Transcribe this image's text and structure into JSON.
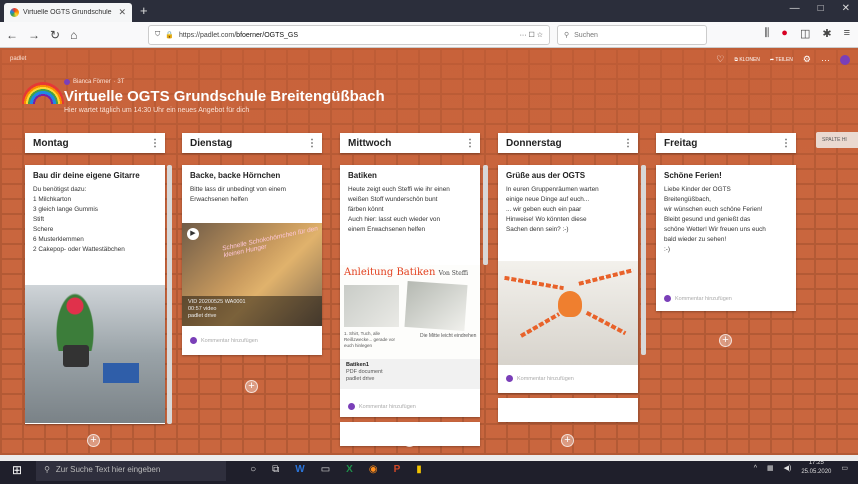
{
  "browser": {
    "tab_title": "Virtuelle OGTS Grundschule Br",
    "tab_close": "✕",
    "new_tab": "+",
    "window_controls": [
      "—",
      "□",
      "✕"
    ],
    "url_prefix": "https://padlet.com/",
    "url_path": "bfoerner/OGTS_GS",
    "url_actions": "··· ☐ ☆",
    "search_placeholder": "Suchen",
    "nav_icons": [
      "back-icon",
      "forward-icon",
      "reload-icon",
      "home-icon"
    ],
    "right_icons": [
      "library-icon",
      "pocket-icon",
      "sidebar-icon",
      "extensions-icon",
      "menu-icon"
    ]
  },
  "padlet": {
    "brand": "padlet",
    "actions": {
      "clone": "KLONEN",
      "share": "TEILEN"
    },
    "author": "Bianca Förner",
    "author_time": "· 3T",
    "title": "Virtuelle OGTS Grundschule Breitengüßbach",
    "subtitle": "Hier wartet täglich um 14:30 Uhr ein neues Angebot für dich",
    "add_column": "SPALTE HI",
    "comment_placeholder": "Kommentar hinzufügen",
    "plus": "+"
  },
  "columns": [
    {
      "title": "Montag",
      "card_title": "Bau dir deine eigene Gitarre",
      "lines": [
        "Du benötigst dazu:",
        "1 Milchkarton",
        "3 gleich lange Gummis",
        "Stift",
        "Schere",
        "6 Musterklemmen",
        "2 Cakepop- oder Wattestäbchen"
      ]
    },
    {
      "title": "Dienstag",
      "card_title": "Backe, backe Hörnchen",
      "lines": [
        "Bitte lass dir unbedingt von einem",
        "Erwachsenen helfen"
      ],
      "video_name": "VID 20200525 WA0001",
      "video_meta": "00:57 video",
      "video_source": "padlet drive",
      "overlay_text": "Schnelle Schokohörnchen für den kleinen Hunger"
    },
    {
      "title": "Mittwoch",
      "card_title": "Batiken",
      "lines": [
        "Heute zeigt euch Steffi wie ihr einen",
        "weißen Stoff wunderschön bunt",
        "färben könnt",
        "Auch hier: lasst euch wieder von",
        "einem Erwachsenen helfen"
      ],
      "doc_heading": "Anleitung Batiken",
      "doc_heading_by": "Von Steffi",
      "doc_note_1": "1. Shirt, Tuch, alle Reißzwecke... gerade vor euch hinlegen",
      "doc_note_2": "Die Mitte leicht eindrehen",
      "file_name": "Batiken1",
      "file_type": "PDF document",
      "file_source": "padlet drive"
    },
    {
      "title": "Donnerstag",
      "card_title": "Grüße aus der OGTS",
      "lines": [
        "In euren Gruppenräumen warten",
        "einige neue Dinge auf euch...",
        "... wir geben euch ein paar",
        "Hinweise! Wo könnten diese",
        "Sachen denn sein? :-)"
      ]
    },
    {
      "title": "Freitag",
      "card_title": "Schöne Ferien!",
      "lines": [
        "Liebe Kinder der OGTS",
        "Breitengüßbach,",
        "wir wünschen euch schöne Ferien!",
        "Bleibt gesund und genießt das",
        "schöne Wetter! Wir freuen uns euch",
        "bald wieder zu sehen!",
        ":-)"
      ]
    }
  ],
  "taskbar": {
    "search_placeholder": "Zur Suche Text hier eingeben",
    "time": "17:25",
    "date": "25.05.2020"
  }
}
